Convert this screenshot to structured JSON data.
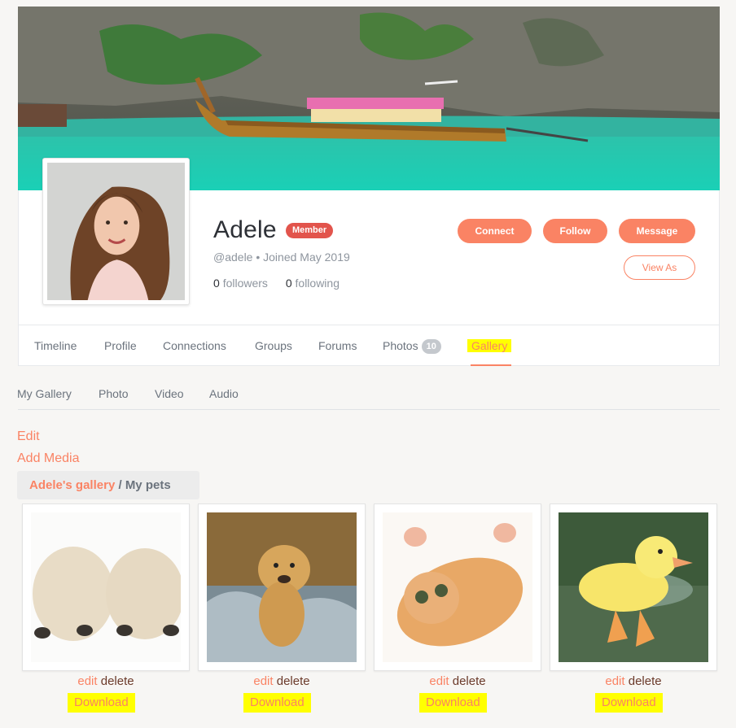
{
  "profile": {
    "name": "Adele",
    "badge": "Member",
    "handle_line": "@adele • Joined May 2019",
    "followers_count": "0",
    "followers_label": "followers",
    "following_count": "0",
    "following_label": "following"
  },
  "actions": {
    "connect": "Connect",
    "follow": "Follow",
    "message": "Message",
    "view_as": "View As"
  },
  "tabs": {
    "timeline": "Timeline",
    "profile": "Profile",
    "connections": "Connections",
    "groups": "Groups",
    "forums": "Forums",
    "photos": "Photos",
    "photos_count": "10",
    "gallery": "Gallery"
  },
  "subtabs": {
    "my_gallery": "My Gallery",
    "photo": "Photo",
    "video": "Video",
    "audio": "Audio"
  },
  "links": {
    "edit": "Edit",
    "add_media": "Add Media"
  },
  "breadcrumb": {
    "home": "Adele's gallery",
    "separator": "/",
    "current": "My pets"
  },
  "media": [
    {
      "subject": "puppies",
      "edit": "edit",
      "delete": "delete",
      "download": "Download"
    },
    {
      "subject": "dog-splashing",
      "edit": "edit",
      "delete": "delete",
      "download": "Download"
    },
    {
      "subject": "kitten",
      "edit": "edit",
      "delete": "delete",
      "download": "Download"
    },
    {
      "subject": "duckling",
      "edit": "edit",
      "delete": "delete",
      "download": "Download"
    }
  ],
  "colors": {
    "accent": "#fa8364",
    "badge": "#e2544c",
    "highlight": "#ffff00"
  }
}
